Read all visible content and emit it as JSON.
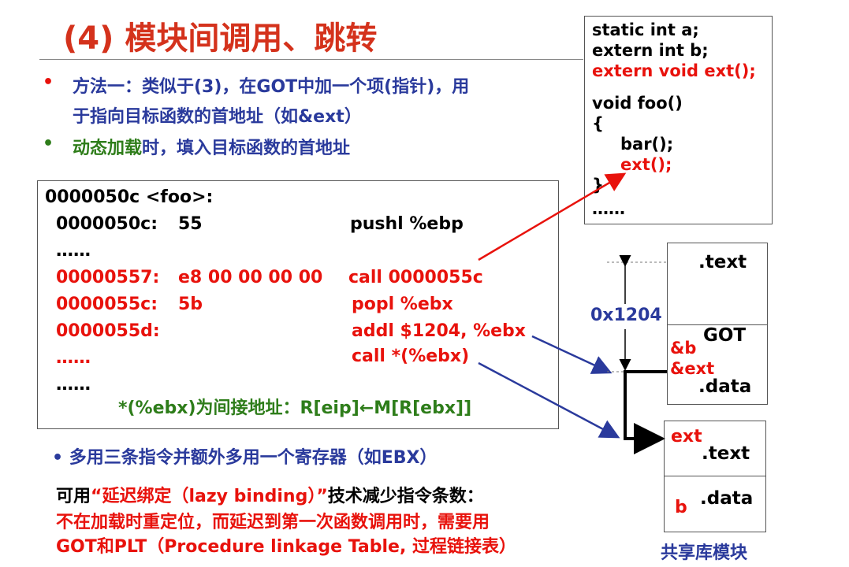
{
  "title": "(4) 模块间调用、跳转",
  "bullets": [
    {
      "mark": "•",
      "line1": "方法一：类似于(3)，在GOT中加一个项(指针)，用",
      "line2": "于指向目标函数的首地址（如&ext）"
    },
    {
      "mark": "•",
      "part_green": "动态加载",
      "part_blue": "时，填入目标函数的首地址"
    }
  ],
  "code": {
    "header": "0000050c <foo>:",
    "rows": [
      {
        "addr": "0000050c:",
        "bytes": "55",
        "instr": "pushl  %ebp"
      },
      {
        "addr": "……",
        "bytes": "",
        "instr": ""
      },
      {
        "addr": "00000557:",
        "bytes": "e8 00 00 00 00",
        "instr": "call   0000055c"
      },
      {
        "addr": "0000055c:",
        "bytes": "5b",
        "instr": "popl  %ebx"
      },
      {
        "addr": "0000055d:",
        "bytes": "",
        "instr": "addl  $1204, %ebx"
      },
      {
        "addr": "……",
        "bytes": "",
        "instr": "call   *(%ebx)"
      },
      {
        "addr": "……",
        "bytes": "",
        "instr": ""
      }
    ],
    "note": "*(%ebx)为间接地址：R[eip]←M[R[ebx]]"
  },
  "source": {
    "lines": [
      "static   int a;",
      "extern int b;",
      "extern  void ext();",
      "void foo()",
      "{",
      "bar();",
      "ext();",
      "}",
      "……"
    ]
  },
  "module1": {
    "text_label": ".text",
    "got_label": "GOT",
    "got_entry1": "&b",
    "got_entry2": "&ext",
    "data_label": ".data",
    "offset": "0x1204"
  },
  "module2": {
    "ext_label": "ext",
    "text_label": ".text",
    "b_label": "b",
    "data_label": ".data",
    "caption": "共享库模块"
  },
  "bottom": {
    "bullet": "• 多用三条指令并额外多用一个寄存器（如EBX）",
    "line1_a": "可用",
    "line1_b": "“延迟绑定（lazy binding）”",
    "line1_c": "技术减少指令条数：",
    "line2": "不在加载时重定位，而延迟到第一次函数调用时，需要用",
    "line3": "GOT和PLT（Procedure linkage Table, 过程链接表）"
  },
  "colors": {
    "title": "#d4321c",
    "red": "#e8120c",
    "blue": "#2a3a9c",
    "green": "#2e7d1a"
  }
}
